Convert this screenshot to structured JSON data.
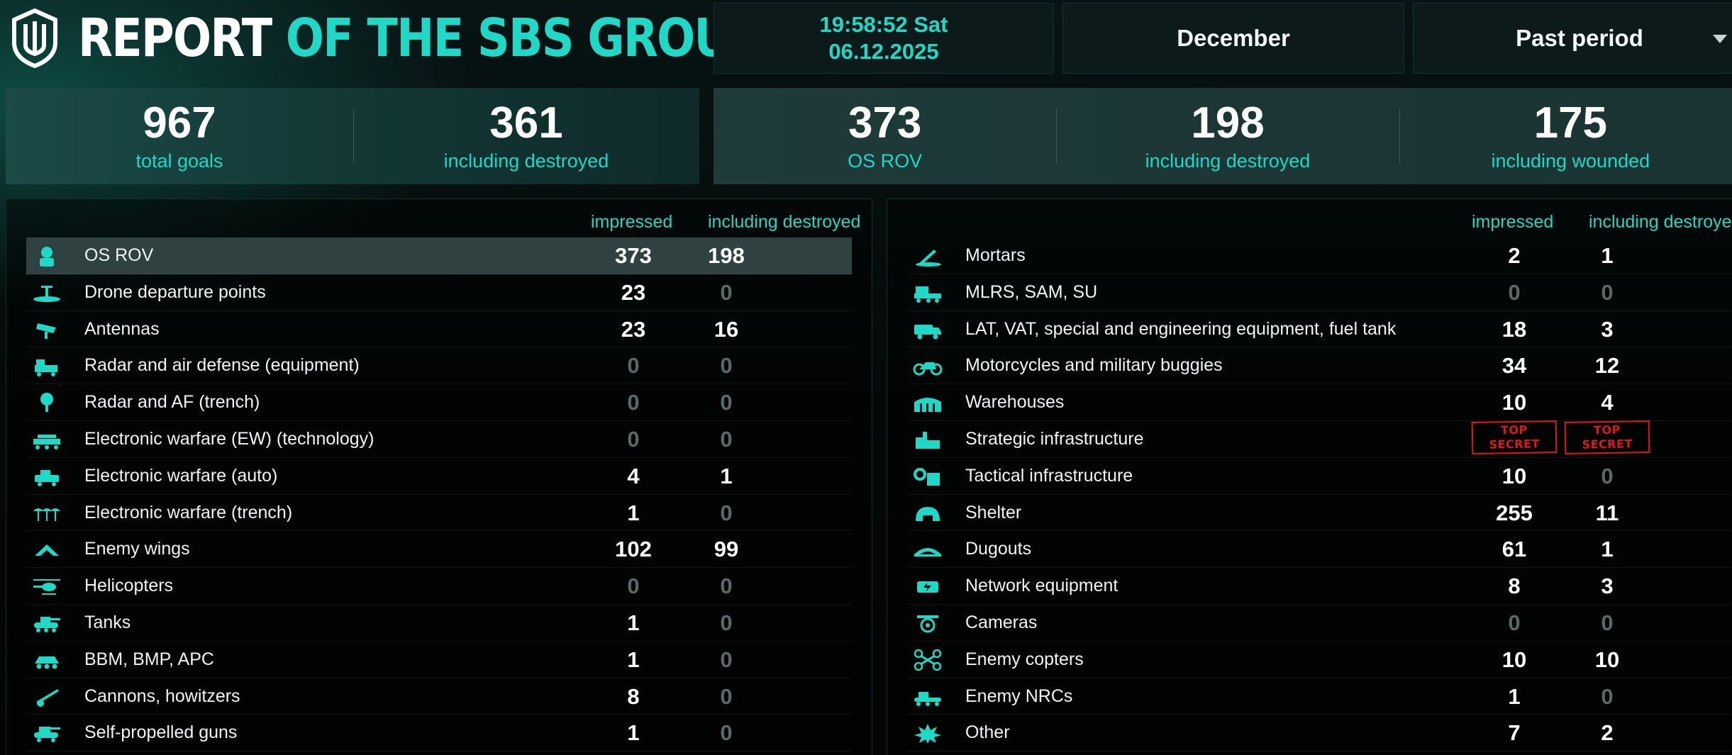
{
  "header": {
    "title_white": "REPORT",
    "title_accent": "OF THE SBS GROUP",
    "clock_time": "19:58:52 Sat",
    "clock_date": "06.12.2025",
    "month": "December",
    "period": "Past period"
  },
  "stats_left": [
    {
      "value": "967",
      "label": "total goals"
    },
    {
      "value": "361",
      "label": "including destroyed"
    }
  ],
  "stats_right": [
    {
      "value": "373",
      "label": "OS ROV"
    },
    {
      "value": "198",
      "label": "including destroyed"
    },
    {
      "value": "175",
      "label": "including wounded"
    }
  ],
  "table_left": {
    "col_impressed": "impressed",
    "col_destroyed": "including destroyed",
    "rows": [
      {
        "icon": "soldier-icon",
        "name": "OS ROV",
        "impressed": "373",
        "destroyed": "198"
      },
      {
        "icon": "drone-launch-icon",
        "name": "Drone departure points",
        "impressed": "23",
        "destroyed": "0"
      },
      {
        "icon": "antenna-dish-icon",
        "name": "Antennas",
        "impressed": "23",
        "destroyed": "16"
      },
      {
        "icon": "radar-vehicle-icon",
        "name": "Radar and air defense (equipment)",
        "impressed": "0",
        "destroyed": "0"
      },
      {
        "icon": "radar-trench-icon",
        "name": "Radar and AF (trench)",
        "impressed": "0",
        "destroyed": "0"
      },
      {
        "icon": "ew-vehicle-icon",
        "name": "Electronic warfare (EW) (technology)",
        "impressed": "0",
        "destroyed": "0"
      },
      {
        "icon": "ew-auto-icon",
        "name": "Electronic warfare (auto)",
        "impressed": "4",
        "destroyed": "1"
      },
      {
        "icon": "ew-trench-icon",
        "name": "Electronic warfare (trench)",
        "impressed": "1",
        "destroyed": "0"
      },
      {
        "icon": "wing-icon",
        "name": "Enemy wings",
        "impressed": "102",
        "destroyed": "99"
      },
      {
        "icon": "helicopter-icon",
        "name": "Helicopters",
        "impressed": "0",
        "destroyed": "0"
      },
      {
        "icon": "tank-icon",
        "name": "Tanks",
        "impressed": "1",
        "destroyed": "0"
      },
      {
        "icon": "apc-icon",
        "name": "BBM, BMP, APC",
        "impressed": "1",
        "destroyed": "0"
      },
      {
        "icon": "cannon-icon",
        "name": "Cannons, howitzers",
        "impressed": "8",
        "destroyed": "0"
      },
      {
        "icon": "spg-icon",
        "name": "Self-propelled guns",
        "impressed": "1",
        "destroyed": "0"
      }
    ]
  },
  "table_right": {
    "col_impressed": "impressed",
    "col_destroyed": "including destroyed",
    "rows": [
      {
        "icon": "mortar-icon",
        "name": "Mortars",
        "impressed": "2",
        "destroyed": "1"
      },
      {
        "icon": "mlrs-icon",
        "name": "MLRS, SAM, SU",
        "impressed": "0",
        "destroyed": "0"
      },
      {
        "icon": "truck-icon",
        "name": "LAT, VAT, special and engineering equipment, fuel tank",
        "impressed": "18",
        "destroyed": "3"
      },
      {
        "icon": "motorcycle-icon",
        "name": "Motorcycles and military buggies",
        "impressed": "34",
        "destroyed": "12"
      },
      {
        "icon": "warehouse-icon",
        "name": "Warehouses",
        "impressed": "10",
        "destroyed": "4"
      },
      {
        "icon": "factory-icon",
        "name": "Strategic infrastructure",
        "impressed": "TOP SECRET",
        "destroyed": "TOP SECRET",
        "secret": true
      },
      {
        "icon": "gear-building-icon",
        "name": "Tactical infrastructure",
        "impressed": "10",
        "destroyed": "0"
      },
      {
        "icon": "shelter-icon",
        "name": "Shelter",
        "impressed": "255",
        "destroyed": "11"
      },
      {
        "icon": "dugout-icon",
        "name": "Dugouts",
        "impressed": "61",
        "destroyed": "1"
      },
      {
        "icon": "network-icon",
        "name": "Network equipment",
        "impressed": "8",
        "destroyed": "3"
      },
      {
        "icon": "camera-icon",
        "name": "Cameras",
        "impressed": "0",
        "destroyed": "0"
      },
      {
        "icon": "copter-icon",
        "name": "Enemy copters",
        "impressed": "10",
        "destroyed": "10"
      },
      {
        "icon": "nrc-icon",
        "name": "Enemy NRCs",
        "impressed": "1",
        "destroyed": "0"
      },
      {
        "icon": "explosion-icon",
        "name": "Other",
        "impressed": "7",
        "destroyed": "2"
      }
    ]
  },
  "colors": {
    "accent": "#1fd8c6",
    "secret": "#e0161c"
  }
}
